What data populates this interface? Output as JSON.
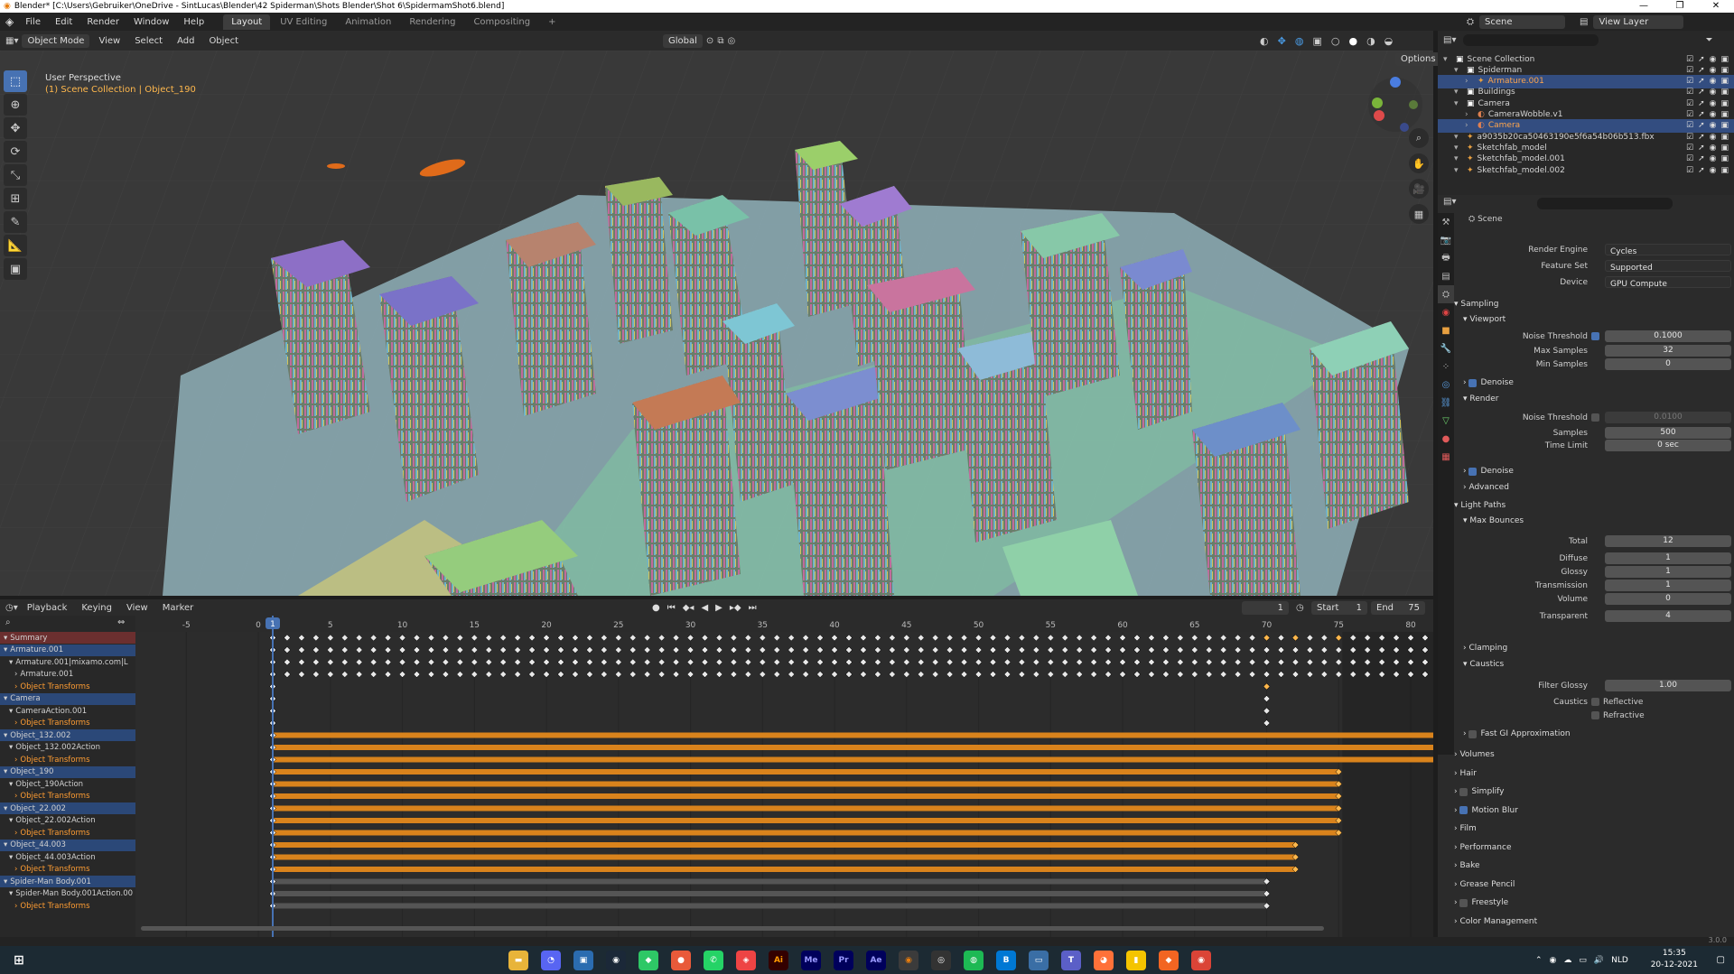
{
  "window": {
    "title": "Blender* [C:\\Users\\Gebruiker\\OneDrive - SintLucas\\Blender\\42 Spiderman\\Shots Blender\\Shot 6\\SpidermamShot6.blend]",
    "min": "—",
    "max": "❐",
    "close": "✕"
  },
  "menubar": {
    "items": [
      "File",
      "Edit",
      "Render",
      "Window",
      "Help"
    ]
  },
  "workspaces": {
    "items": [
      "Layout",
      "UV Editing",
      "Animation",
      "Rendering",
      "Compositing"
    ],
    "active": "Layout",
    "add": "+"
  },
  "scene_selector": {
    "scene": "Scene",
    "view_layer": "View Layer"
  },
  "viewport_header": {
    "mode": "Object Mode",
    "menus": [
      "View",
      "Select",
      "Add",
      "Object"
    ],
    "orientation": "Global",
    "options": "Options"
  },
  "viewport": {
    "perspective": "User Perspective",
    "collection": "(1) Scene Collection | Object_190"
  },
  "outliner": {
    "rows": [
      {
        "label": "Scene Collection",
        "indent": 0,
        "sel": false,
        "icon": "collection-icon"
      },
      {
        "label": "Spiderman",
        "indent": 1,
        "sel": false,
        "icon": "collection-icon"
      },
      {
        "label": "Armature.001",
        "indent": 2,
        "sel": true,
        "icon": "armature-icon"
      },
      {
        "label": "Buildings",
        "indent": 1,
        "sel": false,
        "icon": "collection-icon"
      },
      {
        "label": "Camera",
        "indent": 1,
        "sel": false,
        "icon": "collection-icon"
      },
      {
        "label": "CameraWobble.v1",
        "indent": 2,
        "sel": false,
        "icon": "camera-icon"
      },
      {
        "label": "Camera",
        "indent": 2,
        "sel": true,
        "icon": "camera-icon"
      },
      {
        "label": "a9035b20ca50463190e5f6a54b06b513.fbx",
        "indent": 1,
        "sel": false,
        "icon": "armature-icon"
      },
      {
        "label": "Sketchfab_model",
        "indent": 1,
        "sel": false,
        "icon": "armature-icon"
      },
      {
        "label": "Sketchfab_model.001",
        "indent": 1,
        "sel": false,
        "icon": "armature-icon"
      },
      {
        "label": "Sketchfab_model.002",
        "indent": 1,
        "sel": false,
        "icon": "armature-icon"
      }
    ]
  },
  "properties": {
    "context": "Scene",
    "render_engine": {
      "label": "Render Engine",
      "value": "Cycles"
    },
    "feature_set": {
      "label": "Feature Set",
      "value": "Supported"
    },
    "device": {
      "label": "Device",
      "value": "GPU Compute"
    },
    "sampling": "Sampling",
    "viewport": "Viewport",
    "noise_threshold_label": "Noise Threshold",
    "viewport_noise_threshold": "0.1000",
    "max_samples": {
      "label": "Max Samples",
      "value": "32"
    },
    "min_samples": {
      "label": "Min Samples",
      "value": "0"
    },
    "denoise": "Denoise",
    "render": "Render",
    "render_noise_threshold": "0.0100",
    "samples": {
      "label": "Samples",
      "value": "500"
    },
    "time_limit": {
      "label": "Time Limit",
      "value": "0 sec"
    },
    "advanced": "Advanced",
    "light_paths": "Light Paths",
    "max_bounces": "Max Bounces",
    "bounces": [
      {
        "label": "Total",
        "value": "12"
      },
      {
        "label": "Diffuse",
        "value": "1"
      },
      {
        "label": "Glossy",
        "value": "1"
      },
      {
        "label": "Transmission",
        "value": "1"
      },
      {
        "label": "Volume",
        "value": "0"
      },
      {
        "label": "Transparent",
        "value": "4"
      }
    ],
    "clamping": "Clamping",
    "caustics": "Caustics",
    "filter_glossy": {
      "label": "Filter Glossy",
      "value": "1.00"
    },
    "caustics_label": "Caustics",
    "reflective": "Reflective",
    "refractive": "Refractive",
    "fast_gi": "Fast GI Approximation",
    "sections": [
      "Volumes",
      "Hair",
      "Simplify",
      "Motion Blur",
      "Film",
      "Performance",
      "Bake",
      "Grease Pencil",
      "Freestyle",
      "Color Management"
    ]
  },
  "dopesheet_header": {
    "menus": [
      "Playback",
      "Keying",
      "View",
      "Marker"
    ],
    "current_frame": "1",
    "start_label": "Start",
    "start": "1",
    "end_label": "End",
    "end": "75"
  },
  "timeline": {
    "ticks": [
      "-5",
      "0",
      "5",
      "10",
      "15",
      "20",
      "25",
      "30",
      "35",
      "40",
      "45",
      "50",
      "55",
      "60",
      "65",
      "70",
      "75",
      "80"
    ],
    "current": "1"
  },
  "channels": {
    "rows": [
      {
        "label": "Summary",
        "kind": "summary"
      },
      {
        "label": "Armature.001",
        "kind": "obj"
      },
      {
        "label": "Armature.001|mixamo.com|L",
        "kind": "act"
      },
      {
        "label": "Armature.001",
        "kind": "sub"
      },
      {
        "label": "Object Transforms",
        "kind": "tr"
      },
      {
        "label": "Camera",
        "kind": "obj"
      },
      {
        "label": "CameraAction.001",
        "kind": "act"
      },
      {
        "label": "Object Transforms",
        "kind": "tr"
      },
      {
        "label": "Object_132.002",
        "kind": "obj"
      },
      {
        "label": "Object_132.002Action",
        "kind": "act"
      },
      {
        "label": "Object Transforms",
        "kind": "tr"
      },
      {
        "label": "Object_190",
        "kind": "obj"
      },
      {
        "label": "Object_190Action",
        "kind": "act"
      },
      {
        "label": "Object Transforms",
        "kind": "tr"
      },
      {
        "label": "Object_22.002",
        "kind": "obj"
      },
      {
        "label": "Object_22.002Action",
        "kind": "act"
      },
      {
        "label": "Object Transforms",
        "kind": "tr"
      },
      {
        "label": "Object_44.003",
        "kind": "obj"
      },
      {
        "label": "Object_44.003Action",
        "kind": "act"
      },
      {
        "label": "Object Transforms",
        "kind": "tr"
      },
      {
        "label": "Spider-Man Body.001",
        "kind": "obj"
      },
      {
        "label": "Spider-Man Body.001Action.00",
        "kind": "act"
      },
      {
        "label": "Object Transforms",
        "kind": "tr"
      }
    ]
  },
  "version": "3.0.0",
  "taskbar": {
    "lang": "NLD",
    "time": "15:35",
    "date": "20-12-2021"
  }
}
